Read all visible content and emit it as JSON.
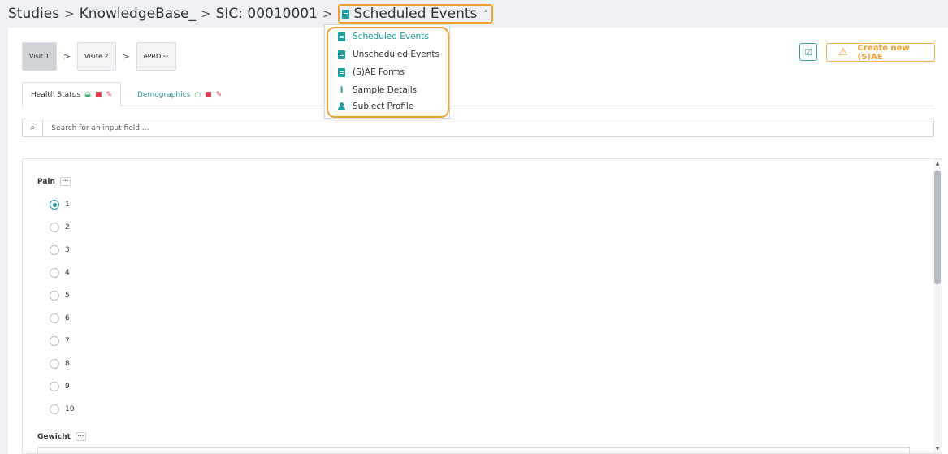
{
  "breadcrumb": {
    "items": [
      "Studies",
      "KnowledgeBase_",
      "SIC: 00010001"
    ],
    "current": "Scheduled Events"
  },
  "visits": {
    "items": [
      "Visit 1",
      "Visite 2",
      "ePRO"
    ]
  },
  "actions": {
    "create_sae_label": "Create new (S)AE"
  },
  "form_tabs": {
    "health_status": "Health Status",
    "demographics": "Demographics"
  },
  "search": {
    "placeholder": "Search for an input field ..."
  },
  "form": {
    "pain_label": "Pain",
    "more_label": "···",
    "pain_options": [
      "1",
      "2",
      "3",
      "4",
      "5",
      "6",
      "7",
      "8",
      "9",
      "10"
    ],
    "pain_selected": "1",
    "gewicht_label": "Gewicht"
  },
  "dropdown": {
    "items": [
      "Scheduled Events",
      "Unscheduled Events",
      "(S)AE Forms",
      "Sample Details",
      "Subject Profile"
    ],
    "active": "Scheduled Events"
  },
  "colors": {
    "accent": "#1a9fa0",
    "highlight": "#f0a030",
    "status_green": "#2ab36a",
    "status_red": "#e0384a"
  }
}
